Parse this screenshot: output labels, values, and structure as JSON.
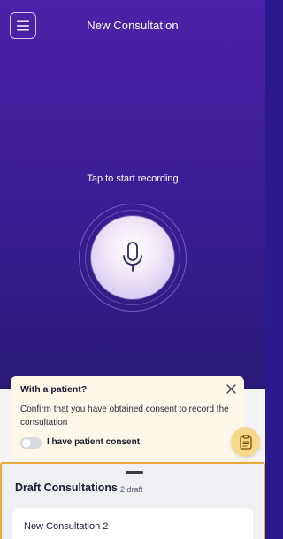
{
  "header": {
    "title": "New Consultation",
    "menu_icon": "hamburger-menu-icon"
  },
  "recorder": {
    "prompt": "Tap to start recording",
    "mic_icon": "microphone-icon"
  },
  "consent": {
    "title": "With a patient?",
    "description": "Confirm that you have obtained consent to record the consultation",
    "toggle_label": "I have patient consent",
    "toggle_on": false,
    "close_icon": "close-icon"
  },
  "fab": {
    "icon": "clipboard-icon"
  },
  "drafts": {
    "title": "Draft Consultations",
    "count_label": "2 draft",
    "items": [
      {
        "name": "New Consultation 2"
      }
    ]
  },
  "colors": {
    "header_purple": "#4b22a8",
    "sheet_highlight": "#e6a93a",
    "consent_bg": "#fdf8e9",
    "fab_bg": "#f6d98b"
  }
}
